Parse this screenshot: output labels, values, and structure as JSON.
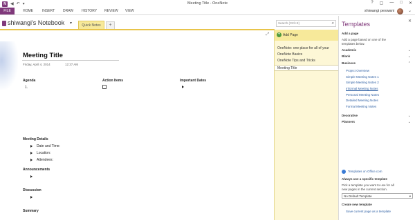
{
  "window": {
    "title": "Meeting Title - OneNote",
    "controls": [
      "?",
      "▢",
      "—",
      "□",
      "✕"
    ]
  },
  "ribbon": {
    "tabs": [
      "FILE",
      "HOME",
      "INSERT",
      "DRAW",
      "HISTORY",
      "REVIEW",
      "VIEW"
    ],
    "user_name": "shiwangi peswani"
  },
  "notebook": {
    "name": "shiwangi's Notebook",
    "section_tab": "Quick Notes",
    "add_tab": "+",
    "search_placeholder": "Search (Ctrl+E)"
  },
  "page": {
    "title": "Meeting Title",
    "date": "Friday, April 4, 2014",
    "time": "12:37 AM",
    "agenda_heading": "Agenda",
    "agenda_item_number": "1.",
    "action_items_heading": "Action Items",
    "important_dates_heading": "Important Dates",
    "meeting_details_heading": "Meeting Details",
    "details": [
      "Date and Time:",
      "Location:",
      "Attendees:"
    ],
    "announcements_heading": "Announcements",
    "discussion_heading": "Discussion",
    "summary_heading": "Summary"
  },
  "pages_pane": {
    "add_page_label": "Add Page",
    "pages": [
      "OneNote: one place for all of your",
      "OneNote Basics",
      "OneNote Tips and Tricks",
      "Meeting Title"
    ],
    "active_index": 3
  },
  "templates": {
    "header": "Templates",
    "add_page_heading": "Add a page",
    "add_page_desc_1": "Add a page based on one of the",
    "add_page_desc_2": "templates below.",
    "categories": {
      "academic": "Academic",
      "blank": "Blank",
      "business": "Business",
      "decorative": "Decorative",
      "planners": "Planners"
    },
    "business_items": [
      "Project Overview",
      "Simple Meeting Notes 1",
      "Simple Meeting Notes 2",
      "Informal Meeting Notes",
      "Personal Meeting Notes",
      "Detailed Meeting Notes",
      "Formal Meeting Notes"
    ],
    "online_link": "Templates on Office.com",
    "always_heading": "Always use a specific template",
    "always_desc_1": "Pick a template you want to use for all",
    "always_desc_2": "new pages in the current section.",
    "default_select": "No Default Template",
    "create_heading": "Create new template",
    "save_link": "Save current page as a template"
  },
  "colors": {
    "brand": "#80397b",
    "section_yellow": "#f7e99a",
    "link_blue": "#2e5fa3"
  }
}
